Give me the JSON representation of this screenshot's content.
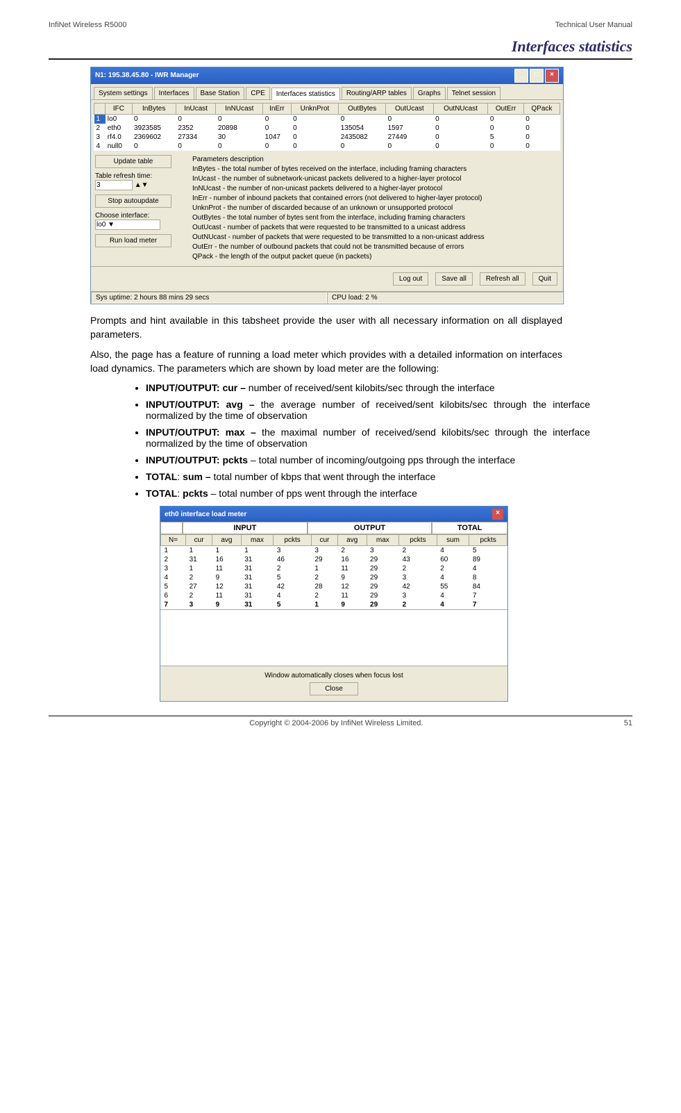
{
  "header": {
    "left": "InfiNet Wireless R5000",
    "right": "Technical User Manual"
  },
  "section_title": "Interfaces statistics",
  "app": {
    "title": "N1: 195.38.45.80 - IWR Manager",
    "tabs": [
      "System settings",
      "Interfaces",
      "Base Station",
      "CPE",
      "Interfaces statistics",
      "Routing/ARP tables",
      "Graphs",
      "Telnet session"
    ],
    "active_tab_index": 4,
    "columns": [
      "",
      "IFC",
      "InBytes",
      "InUcast",
      "InNUcast",
      "InErr",
      "UnknProt",
      "OutBytes",
      "OutUcast",
      "OutNUcast",
      "OutErr",
      "QPack"
    ],
    "rows": [
      [
        "1",
        "lo0",
        "0",
        "0",
        "0",
        "0",
        "0",
        "0",
        "0",
        "0",
        "0",
        "0"
      ],
      [
        "2",
        "eth0",
        "3923585",
        "2352",
        "20898",
        "0",
        "0",
        "135054",
        "1597",
        "0",
        "0",
        "0"
      ],
      [
        "3",
        "rf4.0",
        "2369602",
        "27334",
        "30",
        "1047",
        "0",
        "2435082",
        "27449",
        "0",
        "5",
        "0"
      ],
      [
        "4",
        "null0",
        "0",
        "0",
        "0",
        "0",
        "0",
        "0",
        "0",
        "0",
        "0",
        "0"
      ]
    ],
    "left": {
      "update": "Update table",
      "refresh_label": "Table refresh time:",
      "refresh_value": "3",
      "stop": "Stop autoupdate",
      "choose_label": "Choose interface:",
      "choose_value": "lo0",
      "run": "Run load meter"
    },
    "desc_heading": "Parameters description",
    "desc_lines": [
      "InBytes - the total number of bytes received on the interface, including framing characters",
      "InUcast - the number of subnetwork-unicast packets delivered to a higher-layer protocol",
      "InNUcast - the number of non-unicast packets delivered to a higher-layer protocol",
      "InErr - number of inbound packets that contained errors (not delivered to higher-layer protocol)",
      "UnknProt - the number of discarded because of an unknown or unsupported protocol",
      "OutBytes - the total number of bytes sent from the interface, including framing characters",
      "OutUcast - number of packets that were requested to be transmitted to a unicast address",
      "OutNUcast - number of packets that were requested to be transmitted to a non-unicast address",
      "OutErr - the number of outbound packets that could not be transmitted because of errors",
      "QPack - the length of the output packet queue (in packets)"
    ],
    "bottom_buttons": [
      "Log out",
      "Save all",
      "Refresh all",
      "Quit"
    ],
    "status": {
      "left": "Sys uptime: 2 hours 88 mins 29 secs",
      "right": "CPU load: 2 %"
    }
  },
  "prose": {
    "p1": "Prompts and hint available in this tabsheet provide the user with all necessary information on all displayed parameters.",
    "p2": "Also, the page has a feature of running a load meter which provides with a detailed information on interfaces load dynamics. The parameters which are shown by load meter are the following:"
  },
  "bullets": [
    {
      "bold": "INPUT/OUTPUT: cur – ",
      "rest": "number of received/sent kilobits/sec through the interface"
    },
    {
      "bold": "INPUT/OUTPUT: avg – ",
      "rest": " the average number of received/sent kilobits/sec through the interface normalized by the time of observation"
    },
    {
      "bold": "INPUT/OUTPUT: max – ",
      "rest": "the maximal number of received/send kilobits/sec through the interface normalized by the time of observation"
    },
    {
      "bold": "INPUT/OUTPUT: pckts",
      "rest": " – total number of incoming/outgoing pps through the interface"
    },
    {
      "bold": "TOTAL",
      "rest": ": ",
      "bold2": "sum – ",
      "rest2": "total number of kbps that went through the interface"
    },
    {
      "bold": "TOTAL",
      "rest": ": ",
      "bold2": "pckts",
      "rest2": " – total number of pps went through the interface"
    }
  ],
  "meter": {
    "title": "eth0 interface load meter",
    "groups": [
      "INPUT",
      "OUTPUT",
      "TOTAL"
    ],
    "columns": [
      "N=",
      "cur",
      "avg",
      "max",
      "pckts",
      "cur",
      "avg",
      "max",
      "pckts",
      "sum",
      "pckts"
    ],
    "rows": [
      [
        "1",
        "1",
        "1",
        "1",
        "3",
        "3",
        "2",
        "3",
        "2",
        "4",
        "5"
      ],
      [
        "2",
        "31",
        "16",
        "31",
        "46",
        "29",
        "16",
        "29",
        "43",
        "60",
        "89"
      ],
      [
        "3",
        "1",
        "11",
        "31",
        "2",
        "1",
        "11",
        "29",
        "2",
        "2",
        "4"
      ],
      [
        "4",
        "2",
        "9",
        "31",
        "5",
        "2",
        "9",
        "29",
        "3",
        "4",
        "8"
      ],
      [
        "5",
        "27",
        "12",
        "31",
        "42",
        "28",
        "12",
        "29",
        "42",
        "55",
        "84"
      ],
      [
        "6",
        "2",
        "11",
        "31",
        "4",
        "2",
        "11",
        "29",
        "3",
        "4",
        "7"
      ],
      [
        "7",
        "3",
        "9",
        "31",
        "5",
        "1",
        "9",
        "29",
        "2",
        "4",
        "7"
      ]
    ],
    "bold_last": true,
    "footer_text": "Window automatically closes when focus lost",
    "close_btn": "Close"
  },
  "footer": {
    "center": "Copyright © 2004-2006 by InfiNet Wireless Limited.",
    "right": "51"
  }
}
